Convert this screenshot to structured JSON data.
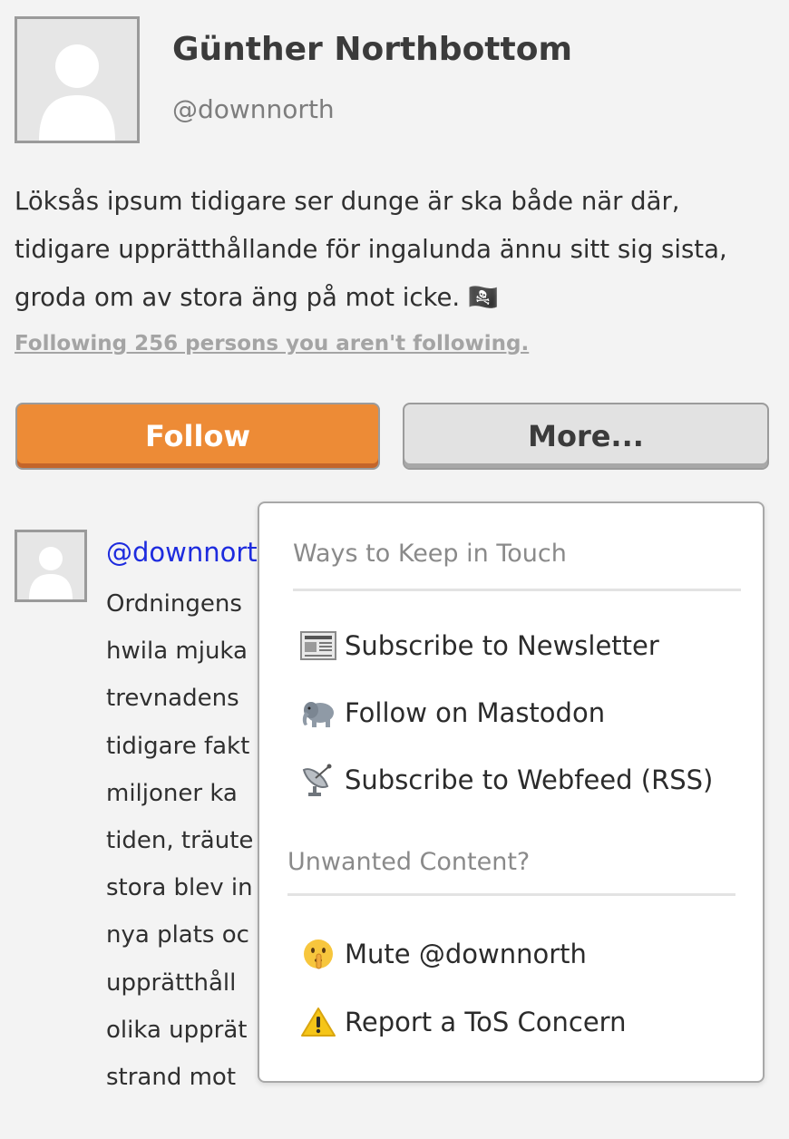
{
  "profile": {
    "name": "Günther Northbottom",
    "handle": "@downnorth",
    "bio": "Löksås ipsum tidigare ser dunge är ska både när där, tidigare upprätthållande för ingalunda ännu sitt sig sista, groda om av stora äng på mot icke. 🏴‍☠️",
    "following_link": "Following 256 persons you aren't following."
  },
  "actions": {
    "follow_label": "Follow",
    "more_label": "More..."
  },
  "post": {
    "handle": "@downnorth",
    "lines": [
      "Ordningens",
      "hwila mjuka",
      "trevnadens",
      "tidigare fakt",
      "miljoner ka",
      "tiden, träute",
      "stora blev in",
      "nya plats oc",
      "upprätthåll",
      "olika upprät",
      "strand mot"
    ]
  },
  "dropdown": {
    "section1_title": "Ways to Keep in Touch",
    "items1": [
      {
        "label": "Subscribe to Newsletter",
        "icon": "newspaper-icon"
      },
      {
        "label": "Follow on Mastodon",
        "icon": "elephant-icon"
      },
      {
        "label": "Subscribe to Webfeed (RSS)",
        "icon": "satellite-dish-icon"
      }
    ],
    "section2_title": "Unwanted Content?",
    "items2": [
      {
        "label": "Mute @downnorth",
        "icon": "shushing-face-icon"
      },
      {
        "label": "Report a ToS Concern",
        "icon": "warning-icon"
      }
    ]
  },
  "colors": {
    "follow_button": "#ed8b36",
    "link_blue": "#1d2bde",
    "background": "#f3f3f3"
  }
}
